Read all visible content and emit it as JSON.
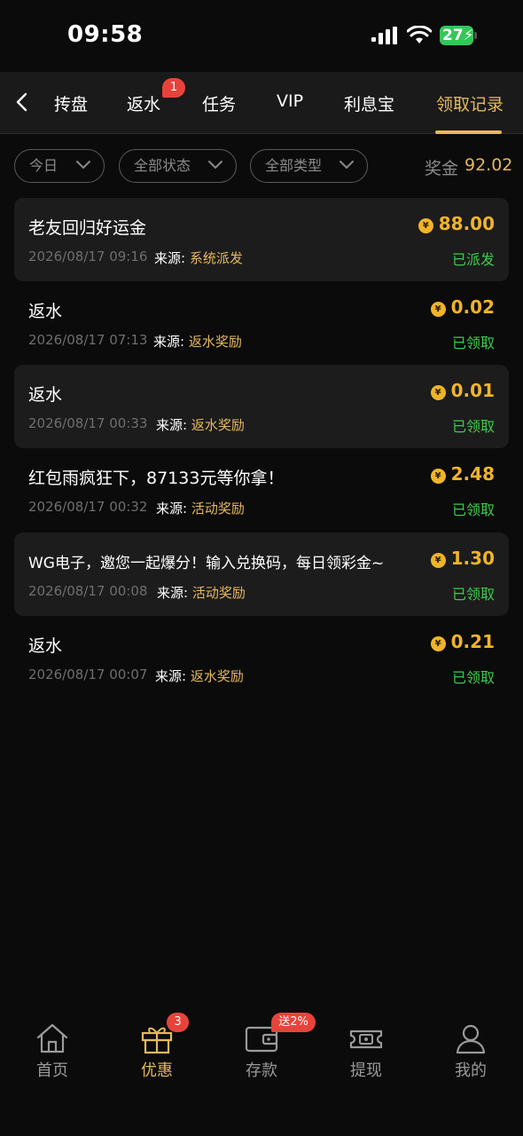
{
  "status_bar": {
    "time": "09:58",
    "battery": "27"
  },
  "tabs": [
    {
      "label": "抟盘"
    },
    {
      "label": "返水",
      "badge": "1"
    },
    {
      "label": "任务"
    },
    {
      "label": "VIP"
    },
    {
      "label": "利息宝"
    },
    {
      "label": "领取记录",
      "active": true
    }
  ],
  "filters": {
    "date": "今日",
    "status": "全部状态",
    "type": "全部类型",
    "bonus_label": "奖金",
    "bonus_value": "92.02"
  },
  "source_label": "来源:",
  "records": [
    {
      "title": "老友回归好运金",
      "date": "2026/08/17 09:16",
      "source": "系统派发",
      "amount": "88.00",
      "status": "已派发"
    },
    {
      "title": "返水",
      "date": "2026/08/17 07:13",
      "source": "返水奖励",
      "amount": "0.02",
      "status": "已领取"
    },
    {
      "title": "返水",
      "date": "2026/08/17 00:33",
      "source": "返水奖励",
      "amount": "0.01",
      "status": "已领取"
    },
    {
      "title": "红包雨疯狂下，87133元等你拿！",
      "date": "2026/08/17 00:32",
      "source": "活动奖励",
      "amount": "2.48",
      "status": "已领取"
    },
    {
      "title": "WG电子，邀您一起爆分！输入兑换码，每日领彩金~",
      "date": "2026/08/17 00:08",
      "source": "活动奖励",
      "amount": "1.30",
      "status": "已领取"
    },
    {
      "title": "返水",
      "date": "2026/08/17 00:07",
      "source": "返水奖励",
      "amount": "0.21",
      "status": "已领取"
    }
  ],
  "bottom_nav": {
    "home": "首页",
    "promo": "优惠",
    "promo_badge": "3",
    "deposit": "存款",
    "deposit_badge": "送2%",
    "withdraw": "提现",
    "mine": "我的"
  },
  "colors": {
    "accent": "#e6b85c",
    "coin": "#f0b429",
    "success": "#3ccb4b",
    "badge": "#e8433a"
  }
}
